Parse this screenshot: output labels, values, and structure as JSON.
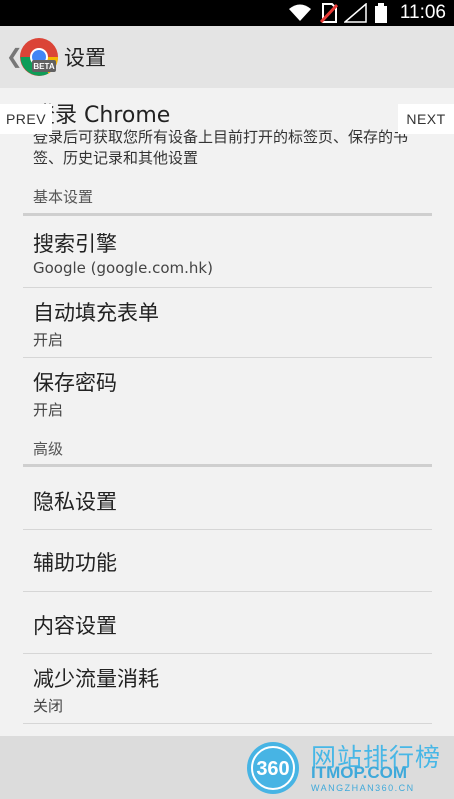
{
  "status_bar": {
    "time": "11:06",
    "icons": [
      "wifi-icon",
      "no-sim-icon",
      "signal-icon",
      "battery-icon"
    ]
  },
  "action_bar": {
    "title": "设置",
    "logo_badge": "BETA"
  },
  "signin": {
    "title": "登录 Chrome",
    "description": "登录后可获取您所有设备上目前打开的标签页、保存的书签、历史记录和其他设置"
  },
  "sections": {
    "basic": "基本设置",
    "advanced": "高级"
  },
  "basic_items": [
    {
      "title": "搜索引擎",
      "summary": "Google (google.com.hk)"
    },
    {
      "title": "自动填充表单",
      "summary": "开启"
    },
    {
      "title": "保存密码",
      "summary": "开启"
    }
  ],
  "advanced_items": [
    {
      "title": "隐私设置"
    },
    {
      "title": "辅助功能"
    },
    {
      "title": "内容设置"
    },
    {
      "title": "减少流量消耗",
      "summary": "关闭"
    }
  ],
  "overlay": {
    "prev": "PREV",
    "next": "NEXT"
  },
  "watermark": {
    "number": "360",
    "title": "网站排行榜",
    "domain": "ITMOP.COM",
    "sub": "WANGZHAN360.CN"
  },
  "colors": {
    "status_bar": "#000000",
    "action_bar": "#e4e4e4",
    "background": "#f2f2f2",
    "watermark": "#48b7e6"
  }
}
